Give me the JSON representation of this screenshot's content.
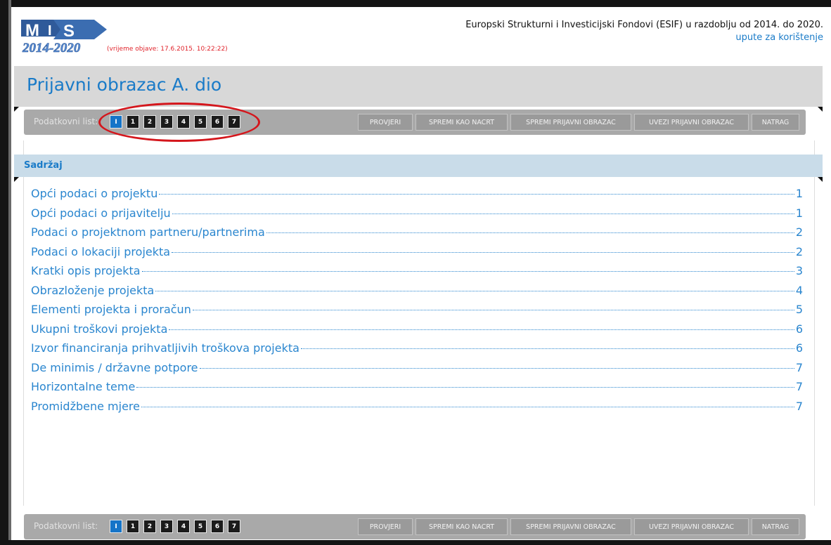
{
  "header": {
    "logo_text": "MIS 2014-2020",
    "publish_time": "(vrijeme objave: 17.6.2015. 10:22:22)",
    "esif_title": "Europski Strukturni i Investicijski Fondovi (ESIF) u razdoblju od 2014. do 2020.",
    "help_link": "upute za korištenje"
  },
  "page_title": "Prijavni obrazac A. dio",
  "toolbar": {
    "label": "Podatkovni list:",
    "pages": [
      "I",
      "1",
      "2",
      "3",
      "4",
      "5",
      "6",
      "7"
    ],
    "active_page": "I",
    "buttons": [
      "PROVJERI",
      "SPREMI KAO NACRT",
      "SPREMI PRIJAVNI OBRAZAC",
      "UVEZI PRIJAVNI OBRAZAC",
      "NATRAG"
    ]
  },
  "section": {
    "title": "Sadržaj"
  },
  "toc": [
    {
      "title": "Opći podaci o projektu",
      "page": "1"
    },
    {
      "title": "Opći podaci o prijavitelju",
      "page": "1"
    },
    {
      "title": "Podaci o projektnom partneru/partnerima",
      "page": "2"
    },
    {
      "title": "Podaci o lokaciji projekta",
      "page": "2"
    },
    {
      "title": "Kratki opis projekta",
      "page": "3"
    },
    {
      "title": "Obrazloženje projekta",
      "page": "4"
    },
    {
      "title": "Elementi projekta i proračun",
      "page": "5"
    },
    {
      "title": "Ukupni troškovi projekta",
      "page": "6"
    },
    {
      "title": "Izvor financiranja prihvatljivih troškova projekta",
      "page": "6"
    },
    {
      "title": "De minimis / državne potpore",
      "page": "7"
    },
    {
      "title": "Horizontalne teme",
      "page": "7"
    },
    {
      "title": "Promidžbene mjere",
      "page": "7"
    }
  ],
  "colors": {
    "accent": "#1a7bc8",
    "active_page": "#1574c8",
    "highlight_circle": "#d4161c",
    "publish_time": "#e0222a"
  }
}
